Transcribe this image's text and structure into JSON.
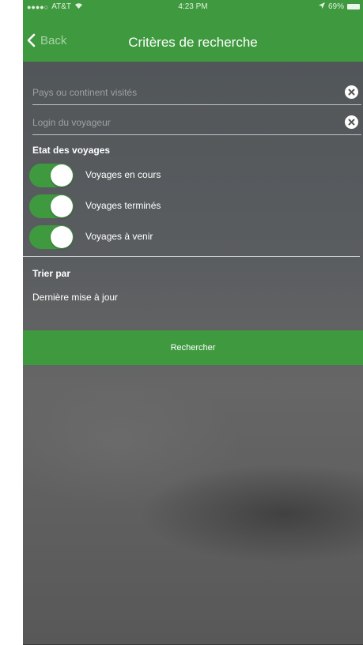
{
  "status_bar": {
    "carrier": "AT&T",
    "signal": "●●●●○",
    "time": "4:23 PM",
    "battery": "69%"
  },
  "nav": {
    "back_label": "Back",
    "title": "Critères de recherche"
  },
  "fields": [
    {
      "placeholder": "Pays ou continent visités",
      "value": ""
    },
    {
      "placeholder": "Login du voyageur",
      "value": ""
    }
  ],
  "trip_state": {
    "title": "Etat des voyages",
    "toggles": [
      {
        "label": "Voyages en cours",
        "on": true
      },
      {
        "label": "Voyages terminés",
        "on": true
      },
      {
        "label": "Voyages à venir",
        "on": true
      }
    ]
  },
  "sort": {
    "title": "Trier par",
    "value": "Dernière mise à jour"
  },
  "search_button_label": "Rechercher",
  "colors": {
    "accent": "#3f9a3f"
  },
  "icons": {
    "back": "chevron-left-icon",
    "clear": "close-circle-icon",
    "wifi": "wifi-icon",
    "location": "location-arrow-icon",
    "battery": "battery-icon"
  }
}
